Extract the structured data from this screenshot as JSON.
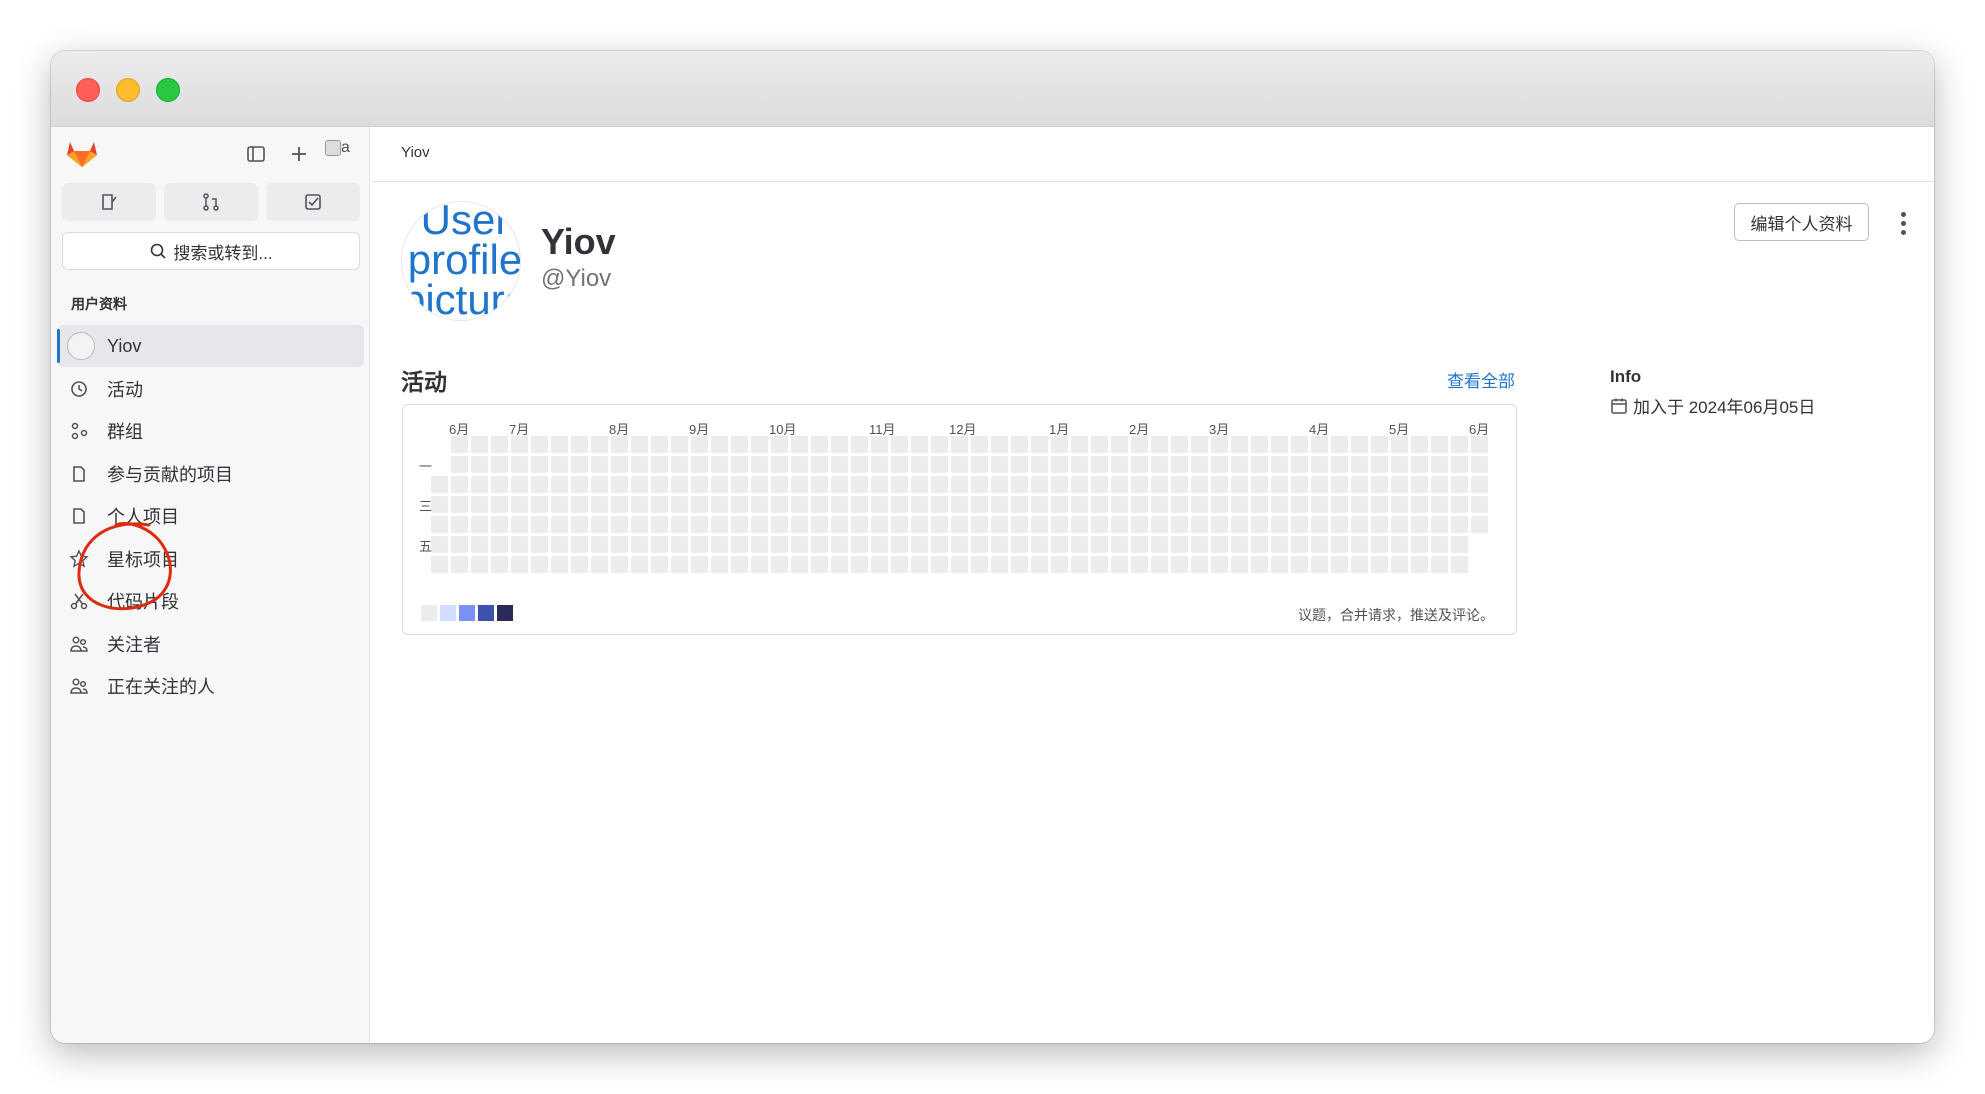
{
  "sidebar": {
    "search_label": "搜索或转到...",
    "section_heading": "用户资料",
    "avatar_alt": "a",
    "items": [
      {
        "label": "Yiov",
        "icon": "user-avatar",
        "active": true
      },
      {
        "label": "活动",
        "icon": "history-icon"
      },
      {
        "label": "群组",
        "icon": "group-icon"
      },
      {
        "label": "参与贡献的项目",
        "icon": "project-icon"
      },
      {
        "label": "个人项目",
        "icon": "project-icon"
      },
      {
        "label": "星标项目",
        "icon": "star-icon"
      },
      {
        "label": "代码片段",
        "icon": "snippet-icon"
      },
      {
        "label": "关注者",
        "icon": "users-icon"
      },
      {
        "label": "正在关注的人",
        "icon": "users-icon"
      }
    ]
  },
  "breadcrumb": "Yiov",
  "profile": {
    "avatar_alt": "User profile picture",
    "name": "Yiov",
    "handle": "@Yiov",
    "edit_label": "编辑个人资料"
  },
  "activity": {
    "title": "活动",
    "view_all": "查看全部",
    "months": [
      "6月",
      "7月",
      "8月",
      "9月",
      "10月",
      "11月",
      "12月",
      "1月",
      "2月",
      "3月",
      "4月",
      "5月",
      "6月"
    ],
    "day_labels": [
      "一",
      "三",
      "五"
    ],
    "legend_text": "议题，合并请求，推送及评论。",
    "legend_colors": [
      "#ececef",
      "#d2dcff",
      "#7992f5",
      "#3f51ae",
      "#2a2b59"
    ],
    "contributions": 0
  },
  "info": {
    "title": "Info",
    "joined": "加入于 2024年06月05日"
  },
  "colors": {
    "accent": "#1f75cb",
    "annotation": "#dd2b0e"
  }
}
